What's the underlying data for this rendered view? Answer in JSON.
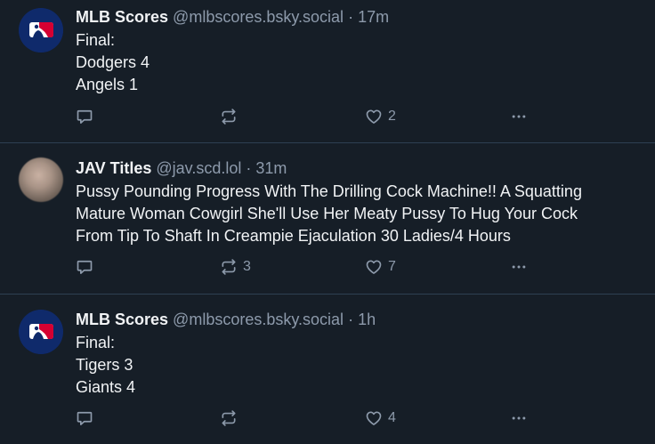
{
  "feed": {
    "posts": [
      {
        "author_name": "MLB Scores",
        "handle": "@mlbscores.bsky.social",
        "separator": "·",
        "time": "17m",
        "lines": [
          "Final:",
          "Dodgers 4",
          "Angels 1"
        ],
        "reply_count": "",
        "repost_count": "",
        "like_count": "2",
        "avatar_icon": "mlb-logo-icon"
      },
      {
        "author_name": "JAV Titles",
        "handle": "@jav.scd.lol",
        "separator": "·",
        "time": "31m",
        "lines": [
          "Pussy Pounding Progress With The Drilling Cock Machine!! A Squatting",
          "Mature Woman Cowgirl She'll Use Her Meaty Pussy To Hug Your Cock",
          "From Tip To Shaft In Creampie Ejaculation 30 Ladies/4 Hours"
        ],
        "reply_count": "",
        "repost_count": "3",
        "like_count": "7",
        "avatar_icon": "blurred-avatar"
      },
      {
        "author_name": "MLB Scores",
        "handle": "@mlbscores.bsky.social",
        "separator": "·",
        "time": "1h",
        "lines": [
          "Final:",
          "Tigers 3",
          "Giants 4"
        ],
        "reply_count": "",
        "repost_count": "",
        "like_count": "4",
        "avatar_icon": "mlb-logo-icon"
      }
    ]
  },
  "icons": {
    "reply": "reply-icon",
    "repost": "repost-icon",
    "like": "heart-icon",
    "more": "more-icon"
  },
  "colors": {
    "background": "#161e27",
    "divider": "#2e4052",
    "text": "#f1f3f5",
    "muted": "#8d9aab",
    "mlb_blue": "#0f2a6b",
    "mlb_red": "#d50032"
  }
}
